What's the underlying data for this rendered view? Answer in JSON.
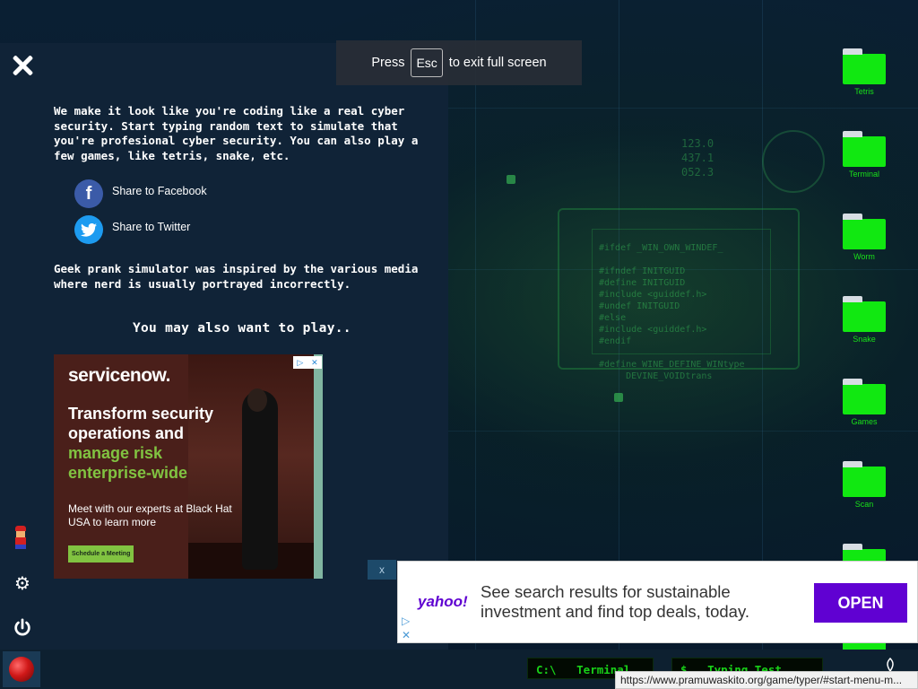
{
  "fullscreen_tip": {
    "press": "Press",
    "key": "Esc",
    "suffix": "to exit full screen"
  },
  "panel": {
    "intro": "We make it look like you're coding like a real cyber security. Start typing random text to simulate that you're profesional cyber security. You can also play a few games, like tetris, snake, etc.",
    "share_facebook": "Share to Facebook",
    "share_twitter": "Share to Twitter",
    "facebook_glyph": "f",
    "inspired": "Geek prank simulator was inspired by the various media where nerd is usually portrayed incorrectly.",
    "also_play": "You may also want to play.."
  },
  "ad": {
    "brand": "servicenow.",
    "headline_1": "Transform security operations and",
    "headline_2": "manage risk enterprise-wide",
    "sub": "Meet with our experts at Black Hat USA to learn more",
    "cta": "Schedule a Meeting",
    "colors": {
      "accent": "#81c341",
      "background": "#4a1f1a"
    }
  },
  "desktop_icons": [
    {
      "label": "Tetris",
      "icon": "folder-icon"
    },
    {
      "label": "Terminal",
      "icon": "folder-icon"
    },
    {
      "label": "Worm",
      "icon": "folder-icon"
    },
    {
      "label": "Snake",
      "icon": "folder-icon"
    },
    {
      "label": "Games",
      "icon": "folder-icon"
    },
    {
      "label": "Scan",
      "icon": "folder-icon"
    }
  ],
  "banner": {
    "close": "x",
    "logo": "yahoo!",
    "text": "See search results for sustainable investment and find top deals, today.",
    "open": "OPEN",
    "colors": {
      "button": "#6001d2"
    }
  },
  "taskbar": {
    "terminal": "C:\\   Terminal",
    "typing_test": "$   Typing Test",
    "status_url": "https://www.pramuwaskito.org/game/typer/#start-menu-m..."
  },
  "background": {
    "numbers": "123.0\n437.1\n052.3",
    "code": "#ifdef _WIN_OWN_WINDEF_\n\n#ifndef INITGUID\n#define INITGUID\n#include <guiddef.h>\n#undef INITGUID\n#else\n#include <guiddef.h>\n#endif\n\n#define WINE_DEFINE_WINtype\n     DEVINE_VOIDtrans"
  },
  "colors": {
    "panel": "#102337",
    "folder": "#11e811",
    "terminal_text": "#18d018"
  }
}
